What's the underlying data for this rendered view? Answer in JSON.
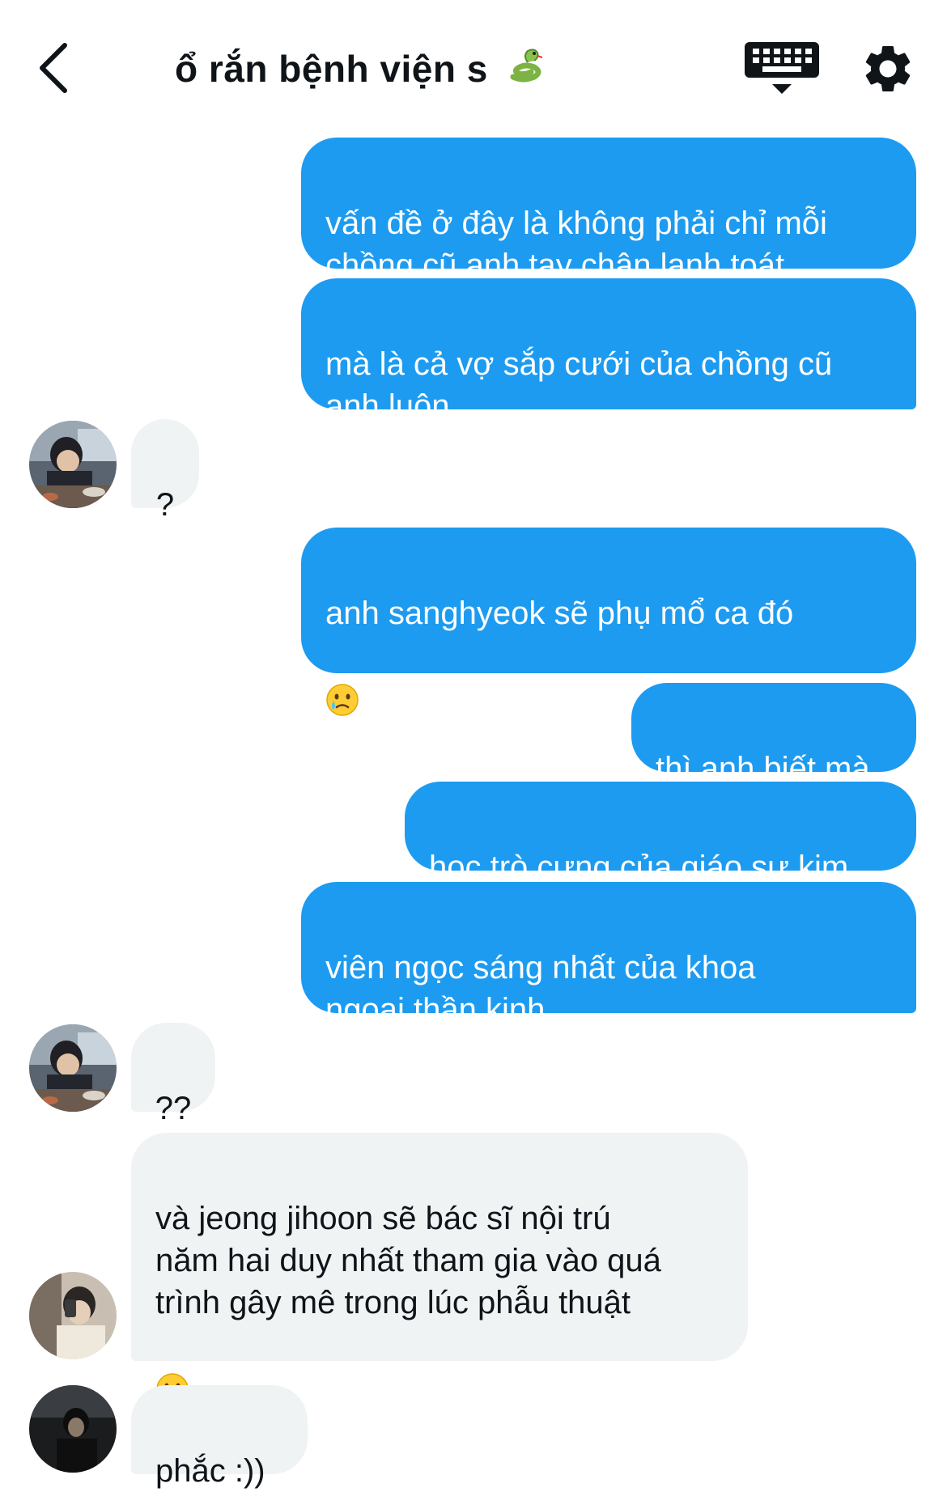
{
  "header": {
    "title": "ổ rắn bệnh viện s",
    "title_emoji": "snake-emoji",
    "back_icon": "chevron-left-icon",
    "keyboard_icon": "keyboard-icon",
    "settings_icon": "gear-icon"
  },
  "colors": {
    "outgoing_bubble": "#1d9bf0",
    "incoming_bubble": "#eff3f4",
    "text": "#0f1419"
  },
  "messages": [
    {
      "direction": "out",
      "text": "vấn đề ở đây là không phải chỉ mỗi\nchồng cũ anh tay chân lạnh toát"
    },
    {
      "direction": "out",
      "text": "mà là cả vợ sắp cưới của chồng cũ\nanh luôn"
    },
    {
      "direction": "in",
      "text": "?",
      "avatar": "avatar-dark-hair"
    },
    {
      "direction": "out",
      "text": "anh sanghyeok sẽ phụ mổ ca đó",
      "emoji": "crying-face-emoji"
    },
    {
      "direction": "out",
      "text": "thì anh biết mà"
    },
    {
      "direction": "out",
      "text": "học trò cưng của giáo sư kim"
    },
    {
      "direction": "out",
      "text": "viên ngọc sáng nhất của khoa\nngoại thần kinh"
    },
    {
      "direction": "in",
      "text": "??",
      "avatar": "avatar-dark-hair"
    },
    {
      "direction": "in",
      "text": "và jeong jihoon sẽ bác sĩ nội trú\nnăm hai duy nhất tham gia vào quá\ntrình gây mê trong lúc phẫu thuật",
      "emoji": "crying-face-emoji",
      "avatar": "avatar-mirror-selfie"
    },
    {
      "direction": "in",
      "text": "phắc :))",
      "avatar": "avatar-night"
    }
  ]
}
